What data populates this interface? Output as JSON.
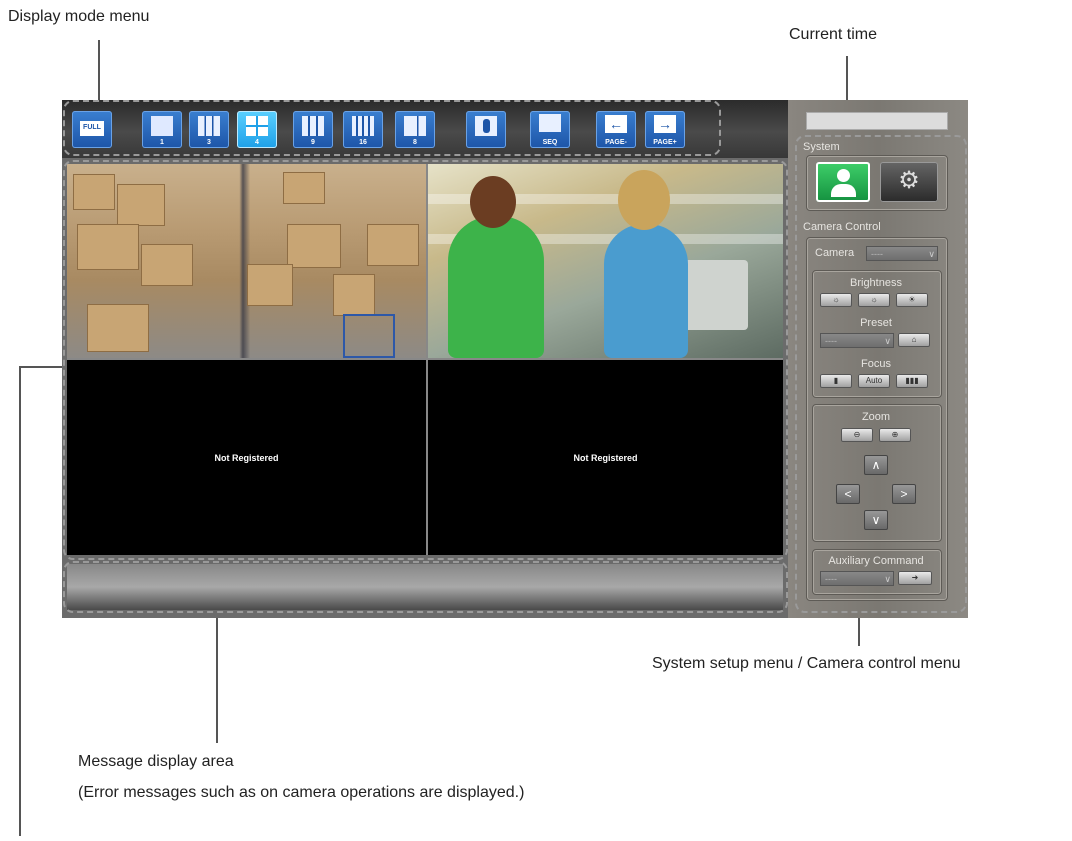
{
  "callouts": {
    "display_mode_menu": "Display mode menu",
    "current_time": "Current time",
    "system_menu": "System setup menu / Camera control menu",
    "message_area": "Message display area",
    "message_area_note": "(Error messages such as on camera operations are displayed.)"
  },
  "toolbar": {
    "full": "FULL",
    "layouts": [
      "1",
      "3",
      "4",
      "9",
      "16",
      "8"
    ],
    "active_layout": "4",
    "seq": "SEQ",
    "page_minus": "PAGE-",
    "page_plus": "PAGE+"
  },
  "screens": [
    {
      "status": ""
    },
    {
      "status": ""
    },
    {
      "status": "Not Registered"
    },
    {
      "status": "Not Registered"
    }
  ],
  "panel": {
    "system_label": "System",
    "camera_control_label": "Camera Control",
    "camera_label": "Camera",
    "camera_select_value": "----",
    "brightness_label": "Brightness",
    "preset_label": "Preset",
    "preset_select_value": "----",
    "focus_label": "Focus",
    "focus_auto": "Auto",
    "zoom_label": "Zoom",
    "aux_label": "Auxiliary Command",
    "aux_select_value": "----"
  },
  "colors": {
    "toolbar_button": "#1d55a8",
    "active_button": "#1ea0e8",
    "system_user_button": "#1aa24a"
  }
}
